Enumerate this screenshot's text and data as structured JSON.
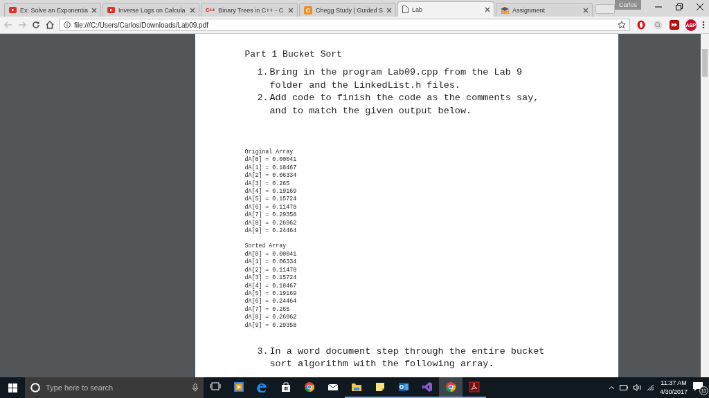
{
  "tabs": [
    {
      "kind": "youtube",
      "label": "Ex: Solve an Exponentia",
      "selected": false
    },
    {
      "kind": "youtube",
      "label": "Inverse Logs on Calcula",
      "selected": false
    },
    {
      "kind": "cpp",
      "icon_text": "C++",
      "label": "Binary Trees in C++ - C",
      "selected": false
    },
    {
      "kind": "chegg",
      "icon_text": "C",
      "label": "Chegg Study | Guided S",
      "selected": false
    },
    {
      "kind": "file",
      "label": "Lab",
      "selected": true
    },
    {
      "kind": "moodle",
      "label": "Assignment",
      "selected": false
    }
  ],
  "profile": "Carlos",
  "address": "file:///C:/Users/Carlos/Downloads/Lab09.pdf",
  "extensions": [
    {
      "kind": "opera"
    },
    {
      "kind": "search"
    },
    {
      "kind": "forward"
    },
    {
      "kind": "abp",
      "text": "ABP"
    }
  ],
  "document": {
    "heading": "Part 1 Bucket Sort",
    "steps": [
      {
        "number": "1.",
        "text": "Bring in the program Lab09.cpp from the Lab 9 folder and the LinkedList.h files."
      },
      {
        "number": "2.",
        "text": "Add code to finish the code as the comments say, and to match the given output below."
      }
    ],
    "output": [
      {
        "title": "Original Array",
        "lines": [
          "dA[0] = 0.00041",
          "dA[1] = 0.18467",
          "dA[2] = 0.06334",
          "dA[3] = 0.265",
          "dA[4] = 0.19169",
          "dA[5] = 0.15724",
          "dA[6] = 0.11478",
          "dA[7] = 0.29358",
          "dA[8] = 0.26962",
          "dA[9] = 0.24464"
        ]
      },
      {
        "title": "Sorted Array",
        "lines": [
          "dA[0] = 0.00041",
          "dA[1] = 0.06334",
          "dA[2] = 0.11478",
          "dA[3] = 0.15724",
          "dA[4] = 0.18467",
          "dA[5] = 0.19169",
          "dA[6] = 0.24464",
          "dA[7] = 0.265",
          "dA[8] = 0.26962",
          "dA[9] = 0.29358"
        ]
      }
    ],
    "more_steps": [
      {
        "number": "3.",
        "text": "In a word document step through the entire bucket sort algorithm with the following array."
      }
    ]
  },
  "taskbar": {
    "search_placeholder": "Type here to search",
    "apps": [
      {
        "kind": "taskview",
        "running": false,
        "selected": false
      },
      {
        "kind": "media",
        "running": false,
        "selected": false
      },
      {
        "kind": "edge",
        "running": false,
        "selected": false
      },
      {
        "kind": "store",
        "running": false,
        "selected": false
      },
      {
        "kind": "chrome",
        "running": false,
        "selected": false
      },
      {
        "kind": "mail",
        "running": false,
        "selected": false
      },
      {
        "kind": "folder",
        "running": true,
        "selected": false
      },
      {
        "kind": "notes",
        "running": true,
        "selected": false
      },
      {
        "kind": "outlook",
        "running": true,
        "selected": false
      },
      {
        "kind": "vs",
        "running": true,
        "selected": false
      },
      {
        "kind": "chrome",
        "running": true,
        "selected": true
      },
      {
        "kind": "acrobat",
        "running": true,
        "selected": false
      }
    ],
    "time": "11:37 AM",
    "date": "4/30/2017",
    "notifications": "11"
  }
}
